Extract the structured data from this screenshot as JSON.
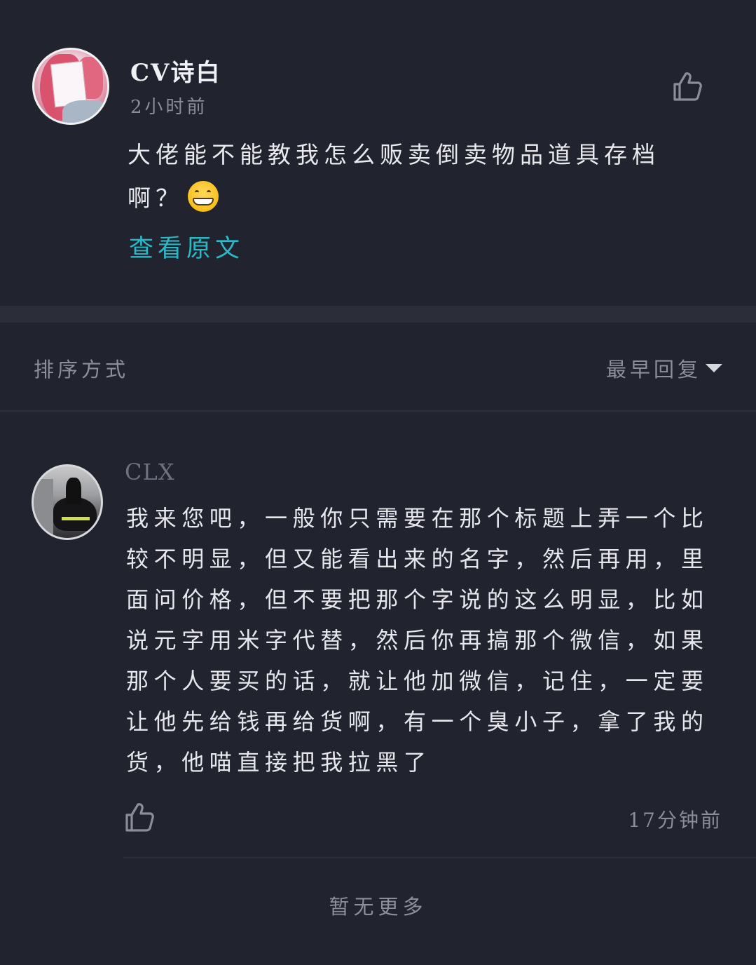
{
  "post": {
    "author": "CV诗白",
    "time": "2小时前",
    "content": "大佬能不能教我怎么贩卖倒卖物品道具存档啊？",
    "emoji": "grinning-face-emoji",
    "view_original": "查看原文"
  },
  "sort": {
    "label": "排序方式",
    "selected": "最早回复"
  },
  "reply": {
    "author": "CLX",
    "content": "我来您吧，一般你只需要在那个标题上弄一个比较不明显，但又能看出来的名字，然后再用，里面问价格，但不要把那个字说的这么明显，比如说元字用米字代替，然后你再搞那个微信，如果那个人要买的话，就让他加微信，记住，一定要让他先给钱再给货啊，有一个臭小子，拿了我的货，他喵直接把我拉黑了",
    "time": "17分钟前"
  },
  "footer": {
    "no_more": "暂无更多"
  },
  "colors": {
    "background": "#21232e",
    "accent_link": "#2cb9c7",
    "muted_text": "#8b8e9a"
  },
  "icons": {
    "like": "thumbs-up-icon",
    "sort_caret": "caret-down-icon"
  }
}
